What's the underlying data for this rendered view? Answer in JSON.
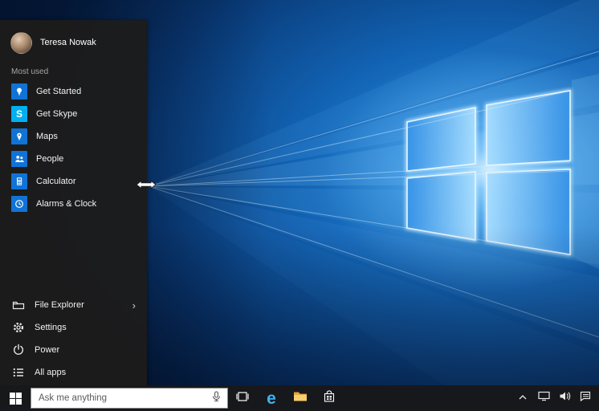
{
  "start_menu": {
    "user": {
      "name": "Teresa Nowak"
    },
    "section_label": "Most used",
    "most_used": [
      {
        "label": "Get Started",
        "tile_color": "#1073d6"
      },
      {
        "label": "Get Skype",
        "tile_color": "#00aff0",
        "glyph": "S"
      },
      {
        "label": "Maps",
        "tile_color": "#1073d6"
      },
      {
        "label": "People",
        "tile_color": "#1073d6"
      },
      {
        "label": "Calculator",
        "tile_color": "#1073d6"
      },
      {
        "label": "Alarms & Clock",
        "tile_color": "#1073d6"
      }
    ],
    "bottom_items": [
      {
        "label": "File Explorer",
        "chevron": "›"
      },
      {
        "label": "Settings"
      },
      {
        "label": "Power"
      },
      {
        "label": "All apps"
      }
    ]
  },
  "taskbar": {
    "search": {
      "placeholder": "Ask me anything"
    },
    "edge_glyph": "e"
  },
  "colors": {
    "accent_tile": "#1073d6",
    "skype_blue": "#00aff0",
    "edge_blue": "#3fb2f0",
    "folder_yellow": "#f7cd70",
    "taskbar_bg": "#17181b",
    "start_menu_bg": "#1c1c1c"
  }
}
